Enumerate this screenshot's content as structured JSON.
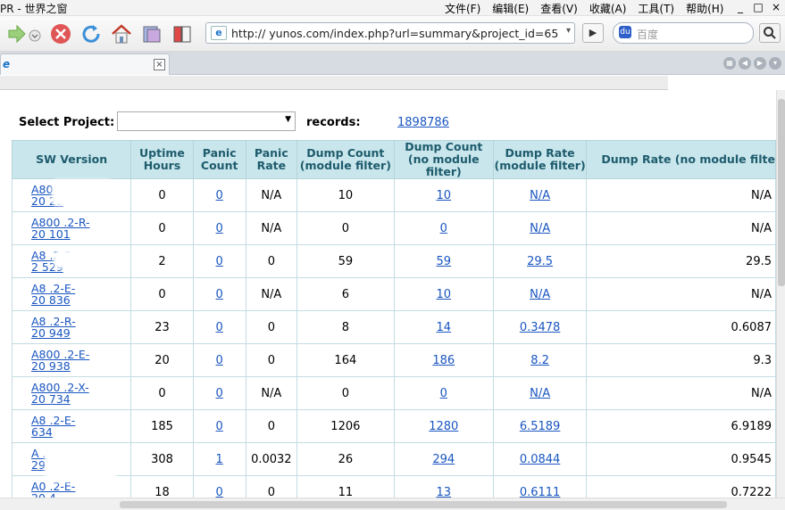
{
  "window": {
    "title": "PR - 世界之窗"
  },
  "menu": [
    "文件(F)",
    "编辑(E)",
    "查看(V)",
    "收藏(A)",
    "工具(T)",
    "帮助(H)"
  ],
  "window_controls": [
    "_",
    "□",
    "×"
  ],
  "toolbar": {
    "icons": [
      "forward-icon",
      "dropdown-icon",
      "stop-icon",
      "refresh-icon",
      "home-icon",
      "history-icon",
      "bookmarks-icon"
    ]
  },
  "address": {
    "url": "http://    yunos.com/index.php?url=summary&project_id=65",
    "ie_label": "e"
  },
  "search": {
    "placeholder": "百度"
  },
  "tab": {
    "label": "e"
  },
  "page": {
    "select_label": "Select Project:",
    "select_value": "",
    "records_label": "     records:",
    "records_value": "1898786"
  },
  "table": {
    "columns": [
      "SW Version",
      "Uptime Hours",
      "Panic Count",
      "Panic Rate",
      "Dump Count (module filter)",
      "Dump Count (no module filter)",
      "Dump Rate (module filter)",
      "Dump Rate (no module filte"
    ],
    "rows": [
      [
        "A800   1-E-",
        "20       25",
        "0",
        "0",
        "N/A",
        "10",
        "10",
        "N/A",
        "N/A"
      ],
      [
        "A800    .2-R-",
        "20       101",
        "0",
        "0",
        "N/A",
        "0",
        "0",
        "N/A",
        "N/A"
      ],
      [
        "A8     .2-R-",
        "2       529",
        "2",
        "0",
        "0",
        "59",
        "59",
        "29.5",
        "29.5"
      ],
      [
        "A8     .2-E-",
        "20       836",
        "0",
        "0",
        "N/A",
        "6",
        "10",
        "N/A",
        "N/A"
      ],
      [
        "A8     .2-R-",
        "20       949",
        "23",
        "0",
        "0",
        "8",
        "14",
        "0.3478",
        "0.6087"
      ],
      [
        "A800   .2-E-",
        "20       938",
        "20",
        "0",
        "0",
        "164",
        "186",
        "8.2",
        "9.3"
      ],
      [
        "A800   .2-X-",
        "20       734",
        "0",
        "0",
        "N/A",
        "0",
        "0",
        "N/A",
        "N/A"
      ],
      [
        "A8     .2-E-",
        "        634",
        "185",
        "0",
        "0",
        "1206",
        "1280",
        "6.5189",
        "6.9189"
      ],
      [
        "A       .2-R-",
        "        29",
        "308",
        "1",
        "0.0032",
        "26",
        "294",
        "0.0844",
        "0.9545"
      ],
      [
        "A0     .2-E-",
        "20       4",
        "18",
        "0",
        "0",
        "11",
        "13",
        "0.6111",
        "0.7222"
      ]
    ]
  }
}
